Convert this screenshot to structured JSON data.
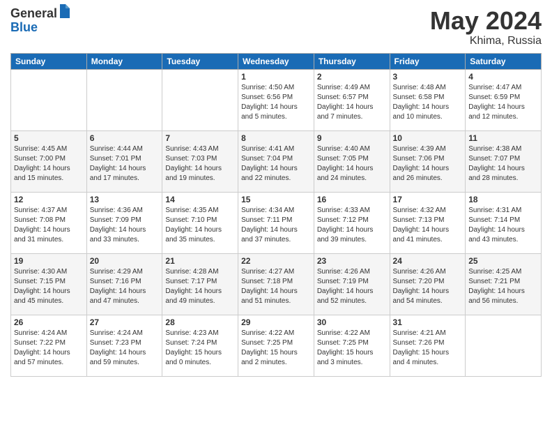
{
  "header": {
    "logo_general": "General",
    "logo_blue": "Blue",
    "month": "May 2024",
    "location": "Khima, Russia"
  },
  "weekdays": [
    "Sunday",
    "Monday",
    "Tuesday",
    "Wednesday",
    "Thursday",
    "Friday",
    "Saturday"
  ],
  "weeks": [
    [
      {
        "day": "",
        "info": ""
      },
      {
        "day": "",
        "info": ""
      },
      {
        "day": "",
        "info": ""
      },
      {
        "day": "1",
        "info": "Sunrise: 4:50 AM\nSunset: 6:56 PM\nDaylight: 14 hours\nand 5 minutes."
      },
      {
        "day": "2",
        "info": "Sunrise: 4:49 AM\nSunset: 6:57 PM\nDaylight: 14 hours\nand 7 minutes."
      },
      {
        "day": "3",
        "info": "Sunrise: 4:48 AM\nSunset: 6:58 PM\nDaylight: 14 hours\nand 10 minutes."
      },
      {
        "day": "4",
        "info": "Sunrise: 4:47 AM\nSunset: 6:59 PM\nDaylight: 14 hours\nand 12 minutes."
      }
    ],
    [
      {
        "day": "5",
        "info": "Sunrise: 4:45 AM\nSunset: 7:00 PM\nDaylight: 14 hours\nand 15 minutes."
      },
      {
        "day": "6",
        "info": "Sunrise: 4:44 AM\nSunset: 7:01 PM\nDaylight: 14 hours\nand 17 minutes."
      },
      {
        "day": "7",
        "info": "Sunrise: 4:43 AM\nSunset: 7:03 PM\nDaylight: 14 hours\nand 19 minutes."
      },
      {
        "day": "8",
        "info": "Sunrise: 4:41 AM\nSunset: 7:04 PM\nDaylight: 14 hours\nand 22 minutes."
      },
      {
        "day": "9",
        "info": "Sunrise: 4:40 AM\nSunset: 7:05 PM\nDaylight: 14 hours\nand 24 minutes."
      },
      {
        "day": "10",
        "info": "Sunrise: 4:39 AM\nSunset: 7:06 PM\nDaylight: 14 hours\nand 26 minutes."
      },
      {
        "day": "11",
        "info": "Sunrise: 4:38 AM\nSunset: 7:07 PM\nDaylight: 14 hours\nand 28 minutes."
      }
    ],
    [
      {
        "day": "12",
        "info": "Sunrise: 4:37 AM\nSunset: 7:08 PM\nDaylight: 14 hours\nand 31 minutes."
      },
      {
        "day": "13",
        "info": "Sunrise: 4:36 AM\nSunset: 7:09 PM\nDaylight: 14 hours\nand 33 minutes."
      },
      {
        "day": "14",
        "info": "Sunrise: 4:35 AM\nSunset: 7:10 PM\nDaylight: 14 hours\nand 35 minutes."
      },
      {
        "day": "15",
        "info": "Sunrise: 4:34 AM\nSunset: 7:11 PM\nDaylight: 14 hours\nand 37 minutes."
      },
      {
        "day": "16",
        "info": "Sunrise: 4:33 AM\nSunset: 7:12 PM\nDaylight: 14 hours\nand 39 minutes."
      },
      {
        "day": "17",
        "info": "Sunrise: 4:32 AM\nSunset: 7:13 PM\nDaylight: 14 hours\nand 41 minutes."
      },
      {
        "day": "18",
        "info": "Sunrise: 4:31 AM\nSunset: 7:14 PM\nDaylight: 14 hours\nand 43 minutes."
      }
    ],
    [
      {
        "day": "19",
        "info": "Sunrise: 4:30 AM\nSunset: 7:15 PM\nDaylight: 14 hours\nand 45 minutes."
      },
      {
        "day": "20",
        "info": "Sunrise: 4:29 AM\nSunset: 7:16 PM\nDaylight: 14 hours\nand 47 minutes."
      },
      {
        "day": "21",
        "info": "Sunrise: 4:28 AM\nSunset: 7:17 PM\nDaylight: 14 hours\nand 49 minutes."
      },
      {
        "day": "22",
        "info": "Sunrise: 4:27 AM\nSunset: 7:18 PM\nDaylight: 14 hours\nand 51 minutes."
      },
      {
        "day": "23",
        "info": "Sunrise: 4:26 AM\nSunset: 7:19 PM\nDaylight: 14 hours\nand 52 minutes."
      },
      {
        "day": "24",
        "info": "Sunrise: 4:26 AM\nSunset: 7:20 PM\nDaylight: 14 hours\nand 54 minutes."
      },
      {
        "day": "25",
        "info": "Sunrise: 4:25 AM\nSunset: 7:21 PM\nDaylight: 14 hours\nand 56 minutes."
      }
    ],
    [
      {
        "day": "26",
        "info": "Sunrise: 4:24 AM\nSunset: 7:22 PM\nDaylight: 14 hours\nand 57 minutes."
      },
      {
        "day": "27",
        "info": "Sunrise: 4:24 AM\nSunset: 7:23 PM\nDaylight: 14 hours\nand 59 minutes."
      },
      {
        "day": "28",
        "info": "Sunrise: 4:23 AM\nSunset: 7:24 PM\nDaylight: 15 hours\nand 0 minutes."
      },
      {
        "day": "29",
        "info": "Sunrise: 4:22 AM\nSunset: 7:25 PM\nDaylight: 15 hours\nand 2 minutes."
      },
      {
        "day": "30",
        "info": "Sunrise: 4:22 AM\nSunset: 7:25 PM\nDaylight: 15 hours\nand 3 minutes."
      },
      {
        "day": "31",
        "info": "Sunrise: 4:21 AM\nSunset: 7:26 PM\nDaylight: 15 hours\nand 4 minutes."
      },
      {
        "day": "",
        "info": ""
      }
    ]
  ]
}
